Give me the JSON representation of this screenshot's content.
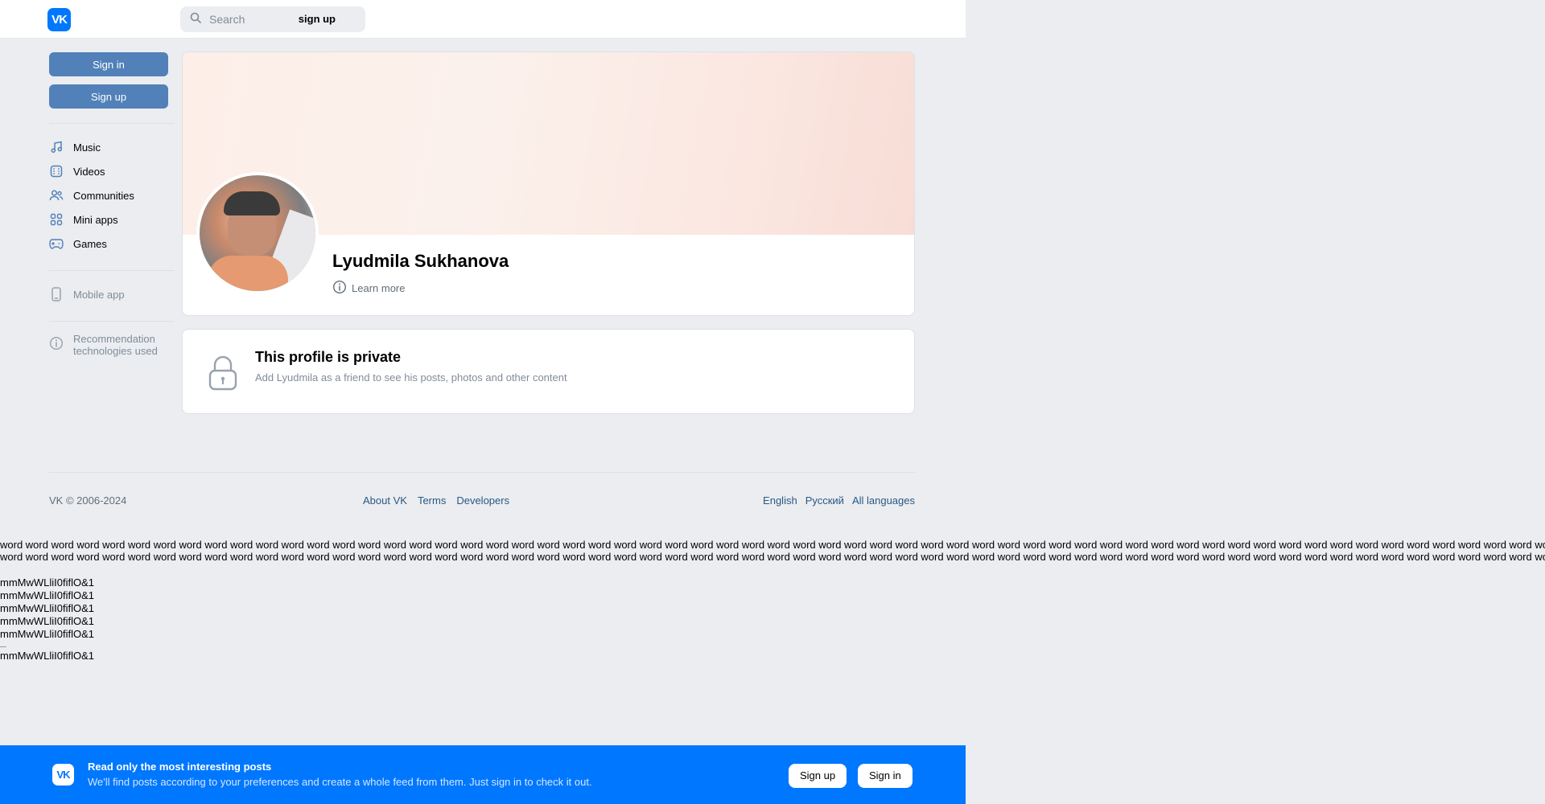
{
  "header": {
    "logo_text": "VK",
    "search_placeholder": "Search",
    "signup_link": "sign up"
  },
  "sidebar": {
    "sign_in_label": "Sign in",
    "sign_up_label": "Sign up",
    "items": [
      {
        "label": "Music",
        "icon": "music-icon"
      },
      {
        "label": "Videos",
        "icon": "video-icon"
      },
      {
        "label": "Communities",
        "icon": "communities-icon"
      },
      {
        "label": "Mini apps",
        "icon": "mini-apps-icon"
      },
      {
        "label": "Games",
        "icon": "games-icon"
      }
    ],
    "mobile_app": "Mobile app",
    "recommendation": "Recommendation technologies used"
  },
  "profile": {
    "name": "Lyudmila Sukhanova",
    "learn_more": "Learn more"
  },
  "private_notice": {
    "title": "This profile is private",
    "subtitle": "Add Lyudmila as a friend to see his posts, photos and other content"
  },
  "footer": {
    "copyright": "VK © 2006-2024",
    "links": [
      "About VK",
      "Terms",
      "Developers"
    ],
    "languages": [
      "English",
      "Русский",
      "All languages"
    ]
  },
  "filler_text": "word word word word word word word word word word word word word word word word word word word word word word word word word word word word word word word word word word word word word word word word word word word word word word word word word word word word word word word word word word word word word word word word word word word word word word word word word word word word word word word word word word word word word word word word word word word word word word word word word word word word word word word word word word word word word word word word word word word word word word word word word word word word word word word word word word word word word word word word word word word word word word word word word word",
  "test_lines": [
    "mmMwWLliI0fiflO&1",
    "mmMwWLliI0fiflO&1",
    "mmMwWLliI0fiflO&1",
    "mmMwWLliI0fiflO&1",
    "mmMwWLliI0fiflO&1",
    "mmMwWLliI0fiflO&1"
  ],
  "banner": {
    "logo_text": "VK",
    "title": "Read only the most interesting posts",
    "subtitle": "We'll find posts according to your preferences and create a whole feed from them. Just sign in to check it out.",
    "sign_up_label": "Sign up",
    "sign_in_label": "Sign in"
  },
  "colors": {
    "brand": "#0077ff",
    "button": "#5181b8",
    "background": "#ebedf0"
  }
}
